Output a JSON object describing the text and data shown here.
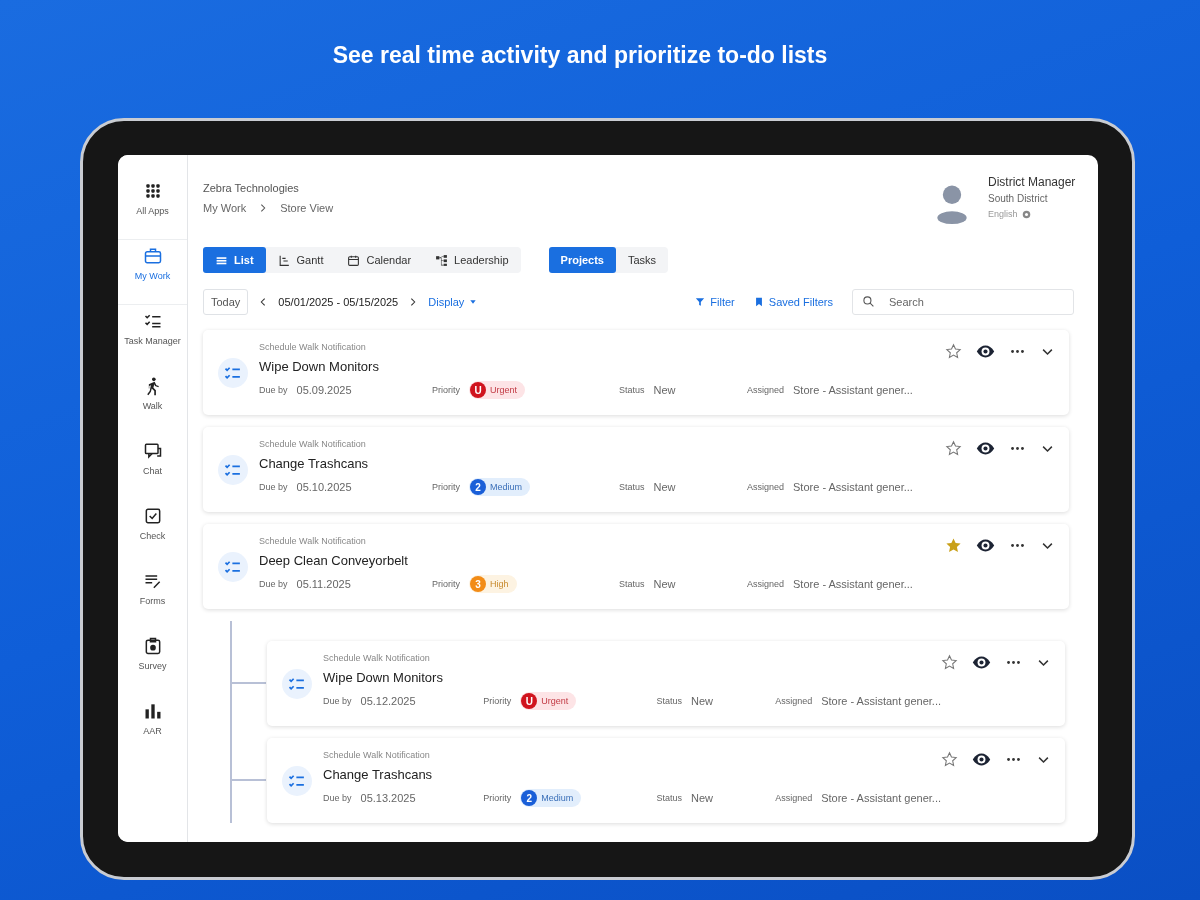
{
  "headline": "See real time activity and prioritize to-do lists",
  "sidebar": {
    "items": [
      {
        "label": "All Apps",
        "kind": "grid",
        "selected": false
      },
      {
        "label": "My Work",
        "kind": "briefcase",
        "selected": true
      },
      {
        "label": "Task Manager",
        "kind": "checklist",
        "selected": false
      },
      {
        "label": "Walk",
        "kind": "walk",
        "selected": false
      },
      {
        "label": "Chat",
        "kind": "chat",
        "selected": false
      },
      {
        "label": "Check",
        "kind": "check",
        "selected": false
      },
      {
        "label": "Forms",
        "kind": "forms",
        "selected": false
      },
      {
        "label": "Survey",
        "kind": "survey",
        "selected": false
      },
      {
        "label": "AAR",
        "kind": "bars",
        "selected": false
      }
    ]
  },
  "header": {
    "company": "Zebra Technologies",
    "breadcrumb": [
      "My Work",
      "Store View"
    ],
    "user": {
      "role": "District Manager",
      "district": "South District",
      "language": "English"
    }
  },
  "view_tabs": [
    {
      "label": "List",
      "kind": "list",
      "selected": true
    },
    {
      "label": "Gantt",
      "kind": "gantt",
      "selected": false
    },
    {
      "label": "Calendar",
      "kind": "calendar",
      "selected": false
    },
    {
      "label": "Leadership",
      "kind": "tree",
      "selected": false
    }
  ],
  "scope_tabs": [
    {
      "label": "Projects",
      "selected": true
    },
    {
      "label": "Tasks",
      "selected": false
    }
  ],
  "toolbar": {
    "today": "Today",
    "date_range": "05/01/2025 - 05/15/2025",
    "display": "Display",
    "filter": "Filter",
    "saved_filters": "Saved Filters",
    "search": {
      "placeholder": "Search"
    }
  },
  "tasks": [
    {
      "category": "Schedule Walk Notification",
      "title": "Wipe Down Monitors",
      "due_label": "Due by",
      "due": "05.09.2025",
      "priority_label": "Priority",
      "priority": {
        "kind": "urgent",
        "mark": "U",
        "label": "Urgent"
      },
      "status_label": "Status",
      "status": "New",
      "assigned_label": "Assigned",
      "assigned": "Store - Assistant gener...",
      "starred": false
    },
    {
      "category": "Schedule Walk Notification",
      "title": "Change Trashcans",
      "due_label": "Due by",
      "due": "05.10.2025",
      "priority_label": "Priority",
      "priority": {
        "kind": "medium",
        "mark": "2",
        "label": "Medium"
      },
      "status_label": "Status",
      "status": "New",
      "assigned_label": "Assigned",
      "assigned": "Store - Assistant gener...",
      "starred": false
    },
    {
      "category": "Schedule Walk Notification",
      "title": "Deep Clean Conveyorbelt",
      "due_label": "Due by",
      "due": "05.11.2025",
      "priority_label": "Priority",
      "priority": {
        "kind": "high",
        "mark": "3",
        "label": "High"
      },
      "status_label": "Status",
      "status": "New",
      "assigned_label": "Assigned",
      "assigned": "Store - Assistant gener...",
      "starred": true,
      "children": [
        {
          "category": "Schedule Walk Notification",
          "title": "Wipe Down Monitors",
          "due_label": "Due by",
          "due": "05.12.2025",
          "priority_label": "Priority",
          "priority": {
            "kind": "urgent",
            "mark": "U",
            "label": "Urgent"
          },
          "status_label": "Status",
          "status": "New",
          "assigned_label": "Assigned",
          "assigned": "Store - Assistant gener...",
          "starred": false
        },
        {
          "category": "Schedule Walk Notification",
          "title": "Change Trashcans",
          "due_label": "Due by",
          "due": "05.13.2025",
          "priority_label": "Priority",
          "priority": {
            "kind": "medium",
            "mark": "2",
            "label": "Medium"
          },
          "status_label": "Status",
          "status": "New",
          "assigned_label": "Assigned",
          "assigned": "Store - Assistant gener...",
          "starred": false
        }
      ]
    }
  ]
}
